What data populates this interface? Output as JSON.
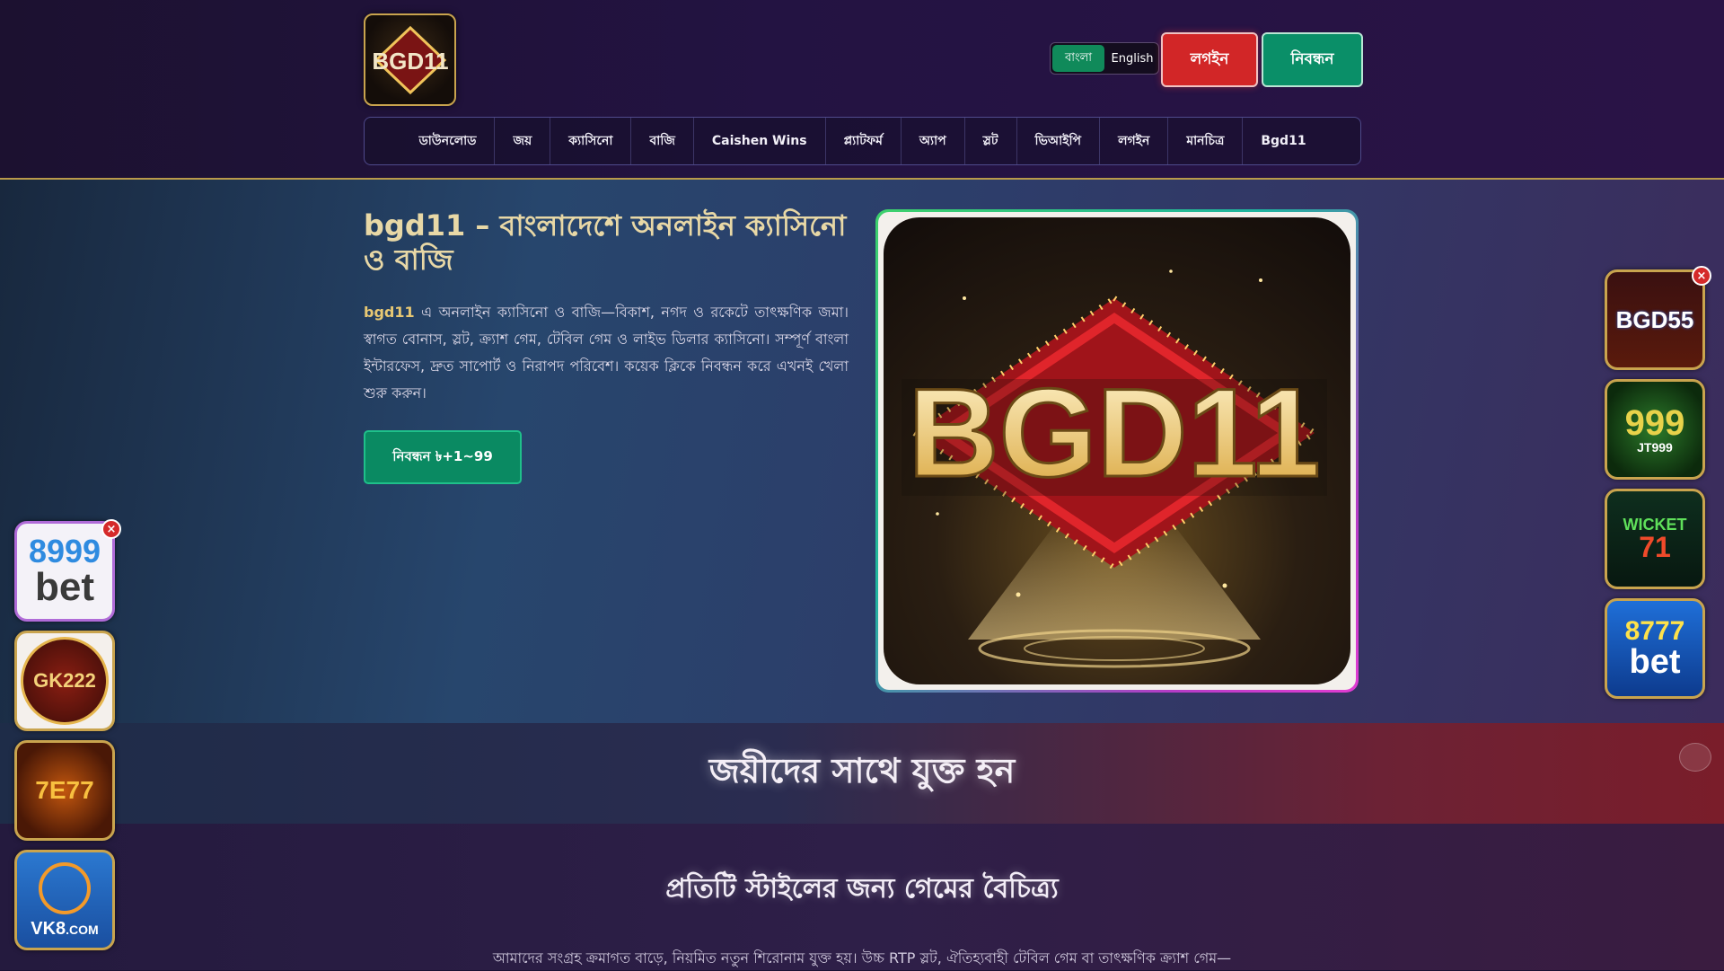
{
  "header": {
    "logo_text": "BGD11",
    "lang": {
      "bangla": "বাংলা",
      "english": "English",
      "active": "bangla"
    },
    "login_label": "লগইন",
    "register_label": "নিবন্ধন"
  },
  "nav": {
    "items": [
      "ডাউনলোড",
      "জয়",
      "ক্যাসিনো",
      "বাজি",
      "Caishen Wins",
      "প্ল্যাটফর্ম",
      "অ্যাপ",
      "স্লট",
      "ভিআইপি",
      "লগইন",
      "মানচিত্র",
      "Bgd11"
    ]
  },
  "hero": {
    "title": "bgd11 – বাংলাদেশে অনলাইন ক্যাসিনো ও বাজি",
    "brand": "bgd11",
    "text": " এ অনলাইন ক্যাসিনো ও বাজি—বিকাশ, নগদ ও রকেটে তাৎক্ষণিক জমা। স্বাগত বোনাস, স্লট, ক্র্যাশ গেম, টেবিল গেম ও লাইভ ডিলার ক্যাসিনো। সম্পূর্ণ বাংলা ইন্টারফেস, দ্রুত সাপোর্ট ও নিরাপদ পরিবেশ। কয়েক ক্লিকে নিবন্ধন করে এখনই খেলা শুরু করুন।",
    "cta_label": "নিবন্ধন ৳+1~99",
    "image_text": "BGD11"
  },
  "banner": {
    "title": "জয়ীদের সাথে যুক্ত হন"
  },
  "section": {
    "title": "প্রতিটি স্টাইলের জন্য গেমের বৈচিত্র্য",
    "text": "আমাদের সংগ্রহ ক্রমাগত বাড়ে, নিয়মিত নতুন শিরোনাম যুক্ত হয়। উচ্চ RTP স্লট, ঐতিহ্যবাহী টেবিল গেম বা তাৎক্ষণিক ক্র্যাশ গেম—"
  },
  "ads": {
    "close": "×",
    "left": [
      {
        "line1": "8999",
        "line2": "bet"
      },
      {
        "line1": "GK222",
        "line2": ""
      },
      {
        "line1": "7E77",
        "line2": ""
      },
      {
        "line1": "VK8",
        "line2": ".COM"
      }
    ],
    "right": [
      {
        "line1": "BGD55",
        "line2": ""
      },
      {
        "line1": "999",
        "line2": "JT999"
      },
      {
        "line1": "WICKET",
        "line2": "71"
      },
      {
        "line1": "8777",
        "line2": "bet"
      }
    ]
  },
  "colors": {
    "login": "#d22627",
    "register": "#0a8f68",
    "accent_gold": "#e8c873"
  }
}
